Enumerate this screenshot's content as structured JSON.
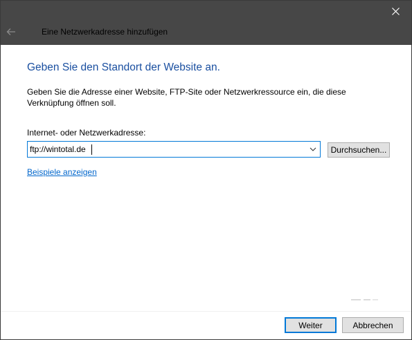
{
  "window": {
    "title": "Eine Netzwerkadresse hinzufügen",
    "close_icon": "close-icon",
    "back_icon": "back-arrow-icon"
  },
  "main": {
    "heading": "Geben Sie den Standort der Website an.",
    "description": "Geben Sie die Adresse einer Website, FTP-Site oder Netzwerkressource ein, die diese Verknüpfung öffnen soll.",
    "field_label": "Internet- oder Netzwerkadresse:",
    "address_value": "ftp://wintotal.de",
    "browse_label": "Durchsuchen...",
    "examples_link": "Beispiele anzeigen"
  },
  "footer": {
    "next_label": "Weiter",
    "cancel_label": "Abbrechen"
  },
  "colors": {
    "titlebar": "#474747",
    "heading": "#1a4fa0",
    "link": "#0066cc",
    "focus_border": "#0078d7"
  }
}
